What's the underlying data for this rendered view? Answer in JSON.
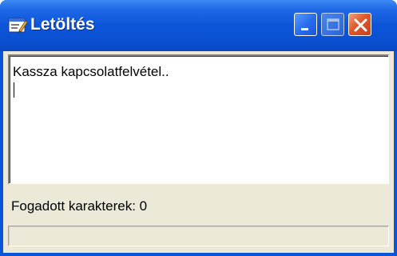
{
  "window": {
    "title": "Letöltés",
    "icon": "app-window-icon",
    "controls": {
      "minimize_icon": "minimize-icon",
      "maximize_icon": "maximize-icon",
      "close_icon": "close-icon"
    }
  },
  "log": {
    "text": "Kassza kapcsolatfelvétel.."
  },
  "status": {
    "received_label": "Fogadott karakterek: 0"
  },
  "progress": {
    "fraction": 0
  },
  "colors": {
    "titlebar": "#0a50d2",
    "face": "#ece9d8",
    "close_button": "#e2562a"
  }
}
